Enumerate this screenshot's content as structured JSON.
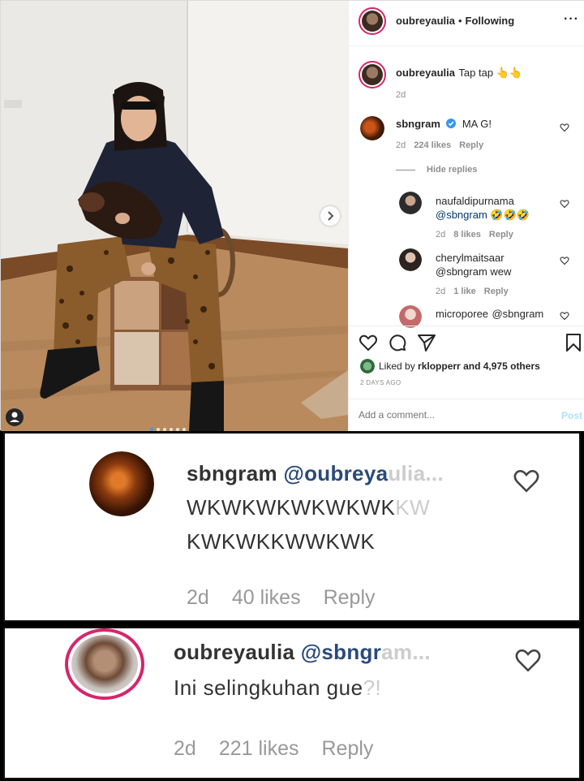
{
  "header": {
    "username": "oubreyaulia",
    "separator": "•",
    "follow_status": "Following",
    "more_glyph": "···"
  },
  "caption": {
    "username": "oubreyaulia",
    "text": "Tap tap 👆👆",
    "time": "2d"
  },
  "comments": [
    {
      "username": "sbngram",
      "verified": true,
      "text": "MA G!",
      "time": "2d",
      "likes": "224 likes",
      "reply": "Reply",
      "hide_replies": "Hide replies"
    }
  ],
  "replies": [
    {
      "username": "naufaldipurnama",
      "text": "@sbngram 🤣🤣🤣",
      "time": "2d",
      "likes": "8 likes",
      "reply": "Reply"
    },
    {
      "username": "cherylmaitsaar",
      "text": "@sbngram wew",
      "time": "2d",
      "likes": "1 like",
      "reply": "Reply"
    },
    {
      "username": "microporee",
      "text": "@sbngram"
    }
  ],
  "likes_line": {
    "prefix": "Liked by",
    "user": "rklopperr",
    "suffix": "and 4,975 others"
  },
  "post_date": "2 DAYS AGO",
  "comment_input": {
    "placeholder": "Add a comment...",
    "post_label": "Post"
  },
  "zoom_comment_1": {
    "username": "sbngram",
    "mention": "@oubreya",
    "mention_faded": "ulia...",
    "line1": "WKWKWKWKWKWK",
    "line1_faded": "KW",
    "line2": "KWKWKKWWKWK",
    "time": "2d",
    "likes": "40 likes",
    "reply": "Reply"
  },
  "zoom_comment_2": {
    "username": "oubreyaulia",
    "mention": "@sbngr",
    "mention_faded": "am...",
    "text": "Ini selingkuhan gue",
    "text_faded": "?!",
    "time": "2d",
    "likes": "221 likes",
    "reply": "Reply"
  },
  "colors": {
    "link": "#00376b",
    "muted": "#8e8e8e",
    "post_button": "#b2dffc",
    "verified": "#3897f0",
    "story_ring": "#d6256b"
  },
  "icons": [
    "heart-icon",
    "comment-icon",
    "share-icon",
    "bookmark-icon",
    "verified-icon",
    "chevron-right-icon",
    "user-tag-icon",
    "more-options-icon"
  ],
  "carousel": {
    "dots": 6,
    "active_index": 0
  }
}
